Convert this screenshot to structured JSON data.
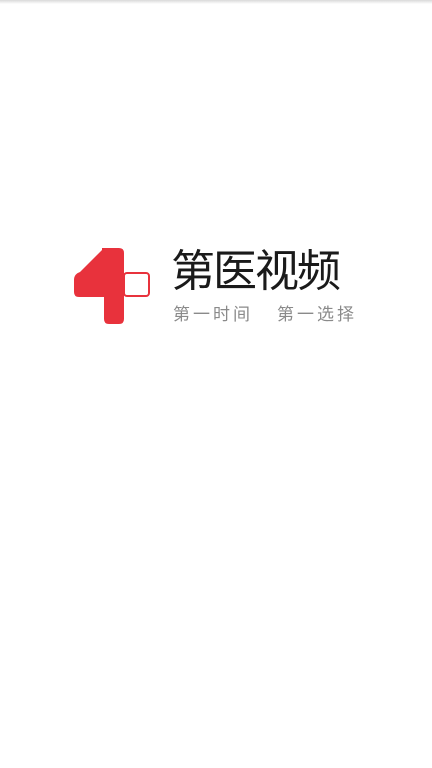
{
  "app": {
    "name": "第医视频",
    "slogan_left": "第一时间",
    "slogan_right": "第一选择"
  },
  "colors": {
    "brand_red": "#e8323c",
    "text_dark": "#1a1a1a",
    "text_gray": "#8a8a8a",
    "background": "#ffffff"
  },
  "icons": {
    "logo": "medical-plus-one-logo-icon"
  }
}
